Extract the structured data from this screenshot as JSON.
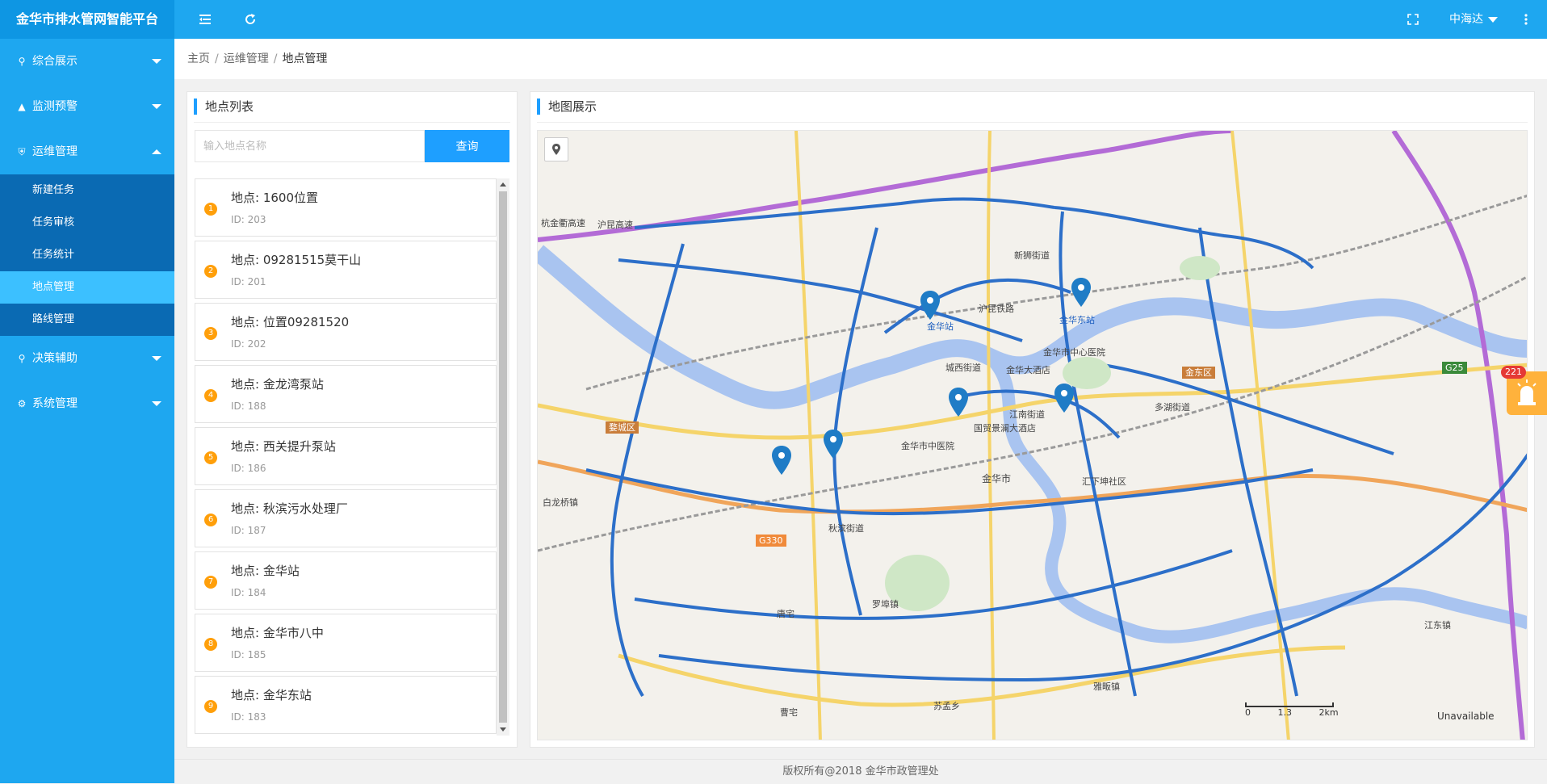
{
  "header": {
    "title": "金华市排水管网智能平台",
    "user": "中海达"
  },
  "sidebar": {
    "items": [
      {
        "label": "综合展示",
        "icon": "map-marker-icon"
      },
      {
        "label": "监测预警",
        "icon": "alarm-icon"
      },
      {
        "label": "运维管理",
        "icon": "shield-icon",
        "expanded": true,
        "children": [
          "新建任务",
          "任务审核",
          "任务统计",
          "地点管理",
          "路线管理"
        ],
        "active_child": "地点管理"
      },
      {
        "label": "决策辅助",
        "icon": "key-icon"
      },
      {
        "label": "系统管理",
        "icon": "gear-icon"
      }
    ]
  },
  "breadcrumb": [
    "主页",
    "运维管理",
    "地点管理"
  ],
  "location_panel": {
    "title": "地点列表",
    "search_placeholder": "输入地点名称",
    "search_button": "查询",
    "items": [
      {
        "num": "1",
        "name": "地点: 1600位置",
        "id": "ID: 203"
      },
      {
        "num": "2",
        "name": "地点: 09281515莫干山",
        "id": "ID: 201"
      },
      {
        "num": "3",
        "name": "地点: 位置09281520",
        "id": "ID: 202"
      },
      {
        "num": "4",
        "name": "地点: 金龙湾泵站",
        "id": "ID: 188"
      },
      {
        "num": "5",
        "name": "地点: 西关提升泵站",
        "id": "ID: 186"
      },
      {
        "num": "6",
        "name": "地点: 秋滨污水处理厂",
        "id": "ID: 187"
      },
      {
        "num": "7",
        "name": "地点: 金华站",
        "id": "ID: 184"
      },
      {
        "num": "8",
        "name": "地点: 金华市八中",
        "id": "ID: 185"
      },
      {
        "num": "9",
        "name": "地点: 金华东站",
        "id": "ID: 183"
      }
    ]
  },
  "map_panel": {
    "title": "地图展示",
    "labels": {
      "jinhua_station": "金华站",
      "jinhua_east": "金华东站",
      "jinhua_city": "金华市",
      "wucheng": "婺城区",
      "jindong": "金东区",
      "xinshi_street": "新狮街道",
      "chengxi_street": "城西街道",
      "jiangnan_street": "江南街道",
      "qiubin_street": "秋滨街道",
      "hospital": "金华市中心医院",
      "hotel": "金华大酒店",
      "zhong_hospital": "金华市中医院",
      "hunan_expressway": "沪昆高速",
      "hangjin": "杭金衢高速",
      "hunan_railway": "沪昆铁路",
      "g330": "G330",
      "g25": "G25",
      "baimu": "白龙桥镇",
      "duohu": "多湖街道",
      "lianyuan": "汇下坤社区",
      "jiangdong": "江东镇",
      "luobu": "罗埠镇",
      "yahui": "雅畈镇",
      "sumeng": "苏孟乡",
      "tangxi": "唐宅",
      "caozhai": "曹宅",
      "jinhuashi_guomao": "国贸景澜大酒店"
    },
    "scale": [
      "0",
      "1.3",
      "2km"
    ],
    "unavailable": "Unavailable"
  },
  "alarm": {
    "count": "221"
  },
  "footer": "版权所有@2018 金华市政管理处",
  "colors": {
    "header": "#1ea7f0",
    "brand": "#0e96e3",
    "submenu": "#0a6ab3",
    "submenu_active": "#3cc0ff",
    "accent": "#1e9fff",
    "badge": "#ff9f0a"
  }
}
